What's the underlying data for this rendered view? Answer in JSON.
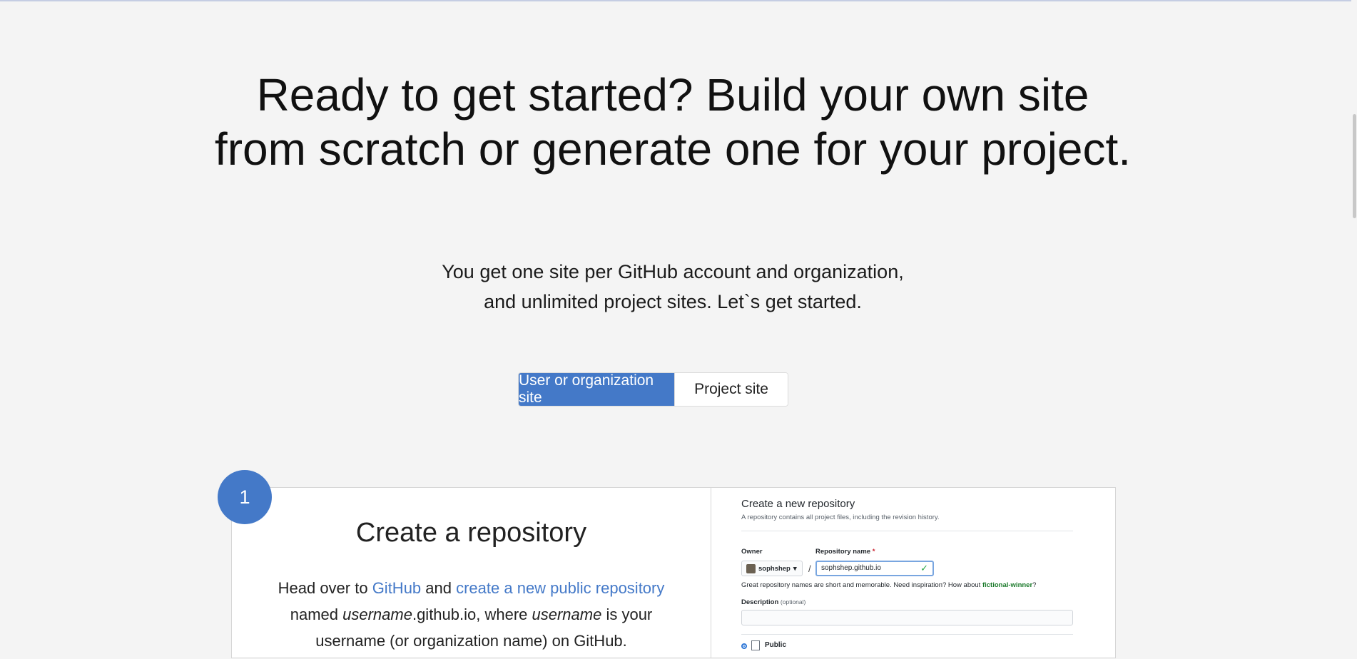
{
  "hero": {
    "title": "Ready to get started? Build your own site from scratch or generate one for your project.",
    "subtitle_line1": "You get one site per GitHub account and organization,",
    "subtitle_line2": "and unlimited project sites. Let`s get started."
  },
  "site_type_toggle": {
    "options": [
      "User or organization site",
      "Project site"
    ],
    "selected": "User or organization site"
  },
  "step1": {
    "number": "1",
    "title": "Create a repository",
    "desc": {
      "head_over": "Head over to ",
      "github_link": "GitHub",
      "and": " and ",
      "create_link": "create a new public repository",
      "named": "named ",
      "username1": "username",
      "github_io": ".github.io, where ",
      "username2": "username",
      "is_your": " is your",
      "line3": "username (or organization name) on GitHub."
    }
  },
  "github_mock": {
    "title": "Create a new repository",
    "subtitle": "A repository contains all project files, including the revision history.",
    "owner_label": "Owner",
    "owner_value": "sophshep",
    "repo_label": "Repository name",
    "required_mark": "*",
    "repo_value": "sophshep.github.io",
    "hint": "Great repository names are short and memorable. Need inspiration? How about ",
    "hint_suggestion": "fictional-winner",
    "hint_end": "?",
    "description_label": "Description",
    "description_optional": "(optional)",
    "visibility_public": "Public"
  },
  "colors": {
    "accent": "#4479c8",
    "background": "#f4f4f4",
    "success": "#28a745"
  }
}
